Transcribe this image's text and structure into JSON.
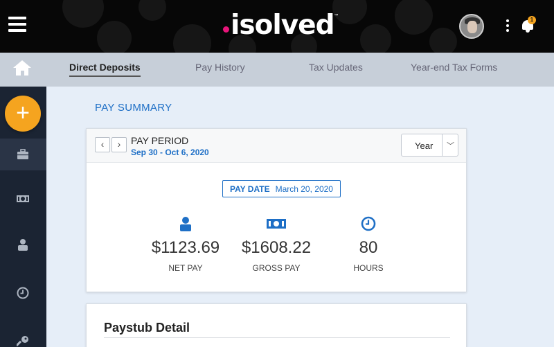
{
  "header": {
    "logo_text": "isolved",
    "logo_mark": "™",
    "notification_count": "1",
    "icons": [
      "hamburger-menu-icon",
      "avatar",
      "kebab-menu-icon",
      "bell-icon"
    ]
  },
  "tabs": [
    {
      "label": "Direct Deposits",
      "active": true
    },
    {
      "label": "Pay History",
      "active": false
    },
    {
      "label": "Tax Updates",
      "active": false
    },
    {
      "label": "Year-end Tax Forms",
      "active": false
    }
  ],
  "sidebar": {
    "fab_label": "+",
    "items": [
      {
        "icon": "briefcase-icon",
        "selected": true
      },
      {
        "icon": "money-icon",
        "selected": false
      },
      {
        "icon": "person-icon",
        "selected": false
      },
      {
        "icon": "clock-icon",
        "selected": false
      },
      {
        "icon": "key-icon",
        "selected": false
      }
    ]
  },
  "main": {
    "section_title": "PAY SUMMARY",
    "pay_period": {
      "label": "PAY PERIOD",
      "range": "Sep 30 - Oct 6, 2020",
      "prev": "‹",
      "next": "›"
    },
    "view_select": {
      "value": "Year"
    },
    "pay_date": {
      "label": "PAY DATE",
      "value": "March 20, 2020"
    },
    "stats": [
      {
        "amount": "$1123.69",
        "label": "NET PAY",
        "icon": "person-icon"
      },
      {
        "amount": "$1608.22",
        "label": "GROSS PAY",
        "icon": "money-icon"
      },
      {
        "amount": "80",
        "label": "HOURS",
        "icon": "clock-icon"
      }
    ],
    "paystub_title": "Paystub Detail"
  },
  "colors": {
    "accent_blue": "#1e6fc6",
    "fab_orange": "#f5a41f",
    "logo_pink": "#e8157a",
    "sidebar_bg": "#1b2433"
  }
}
